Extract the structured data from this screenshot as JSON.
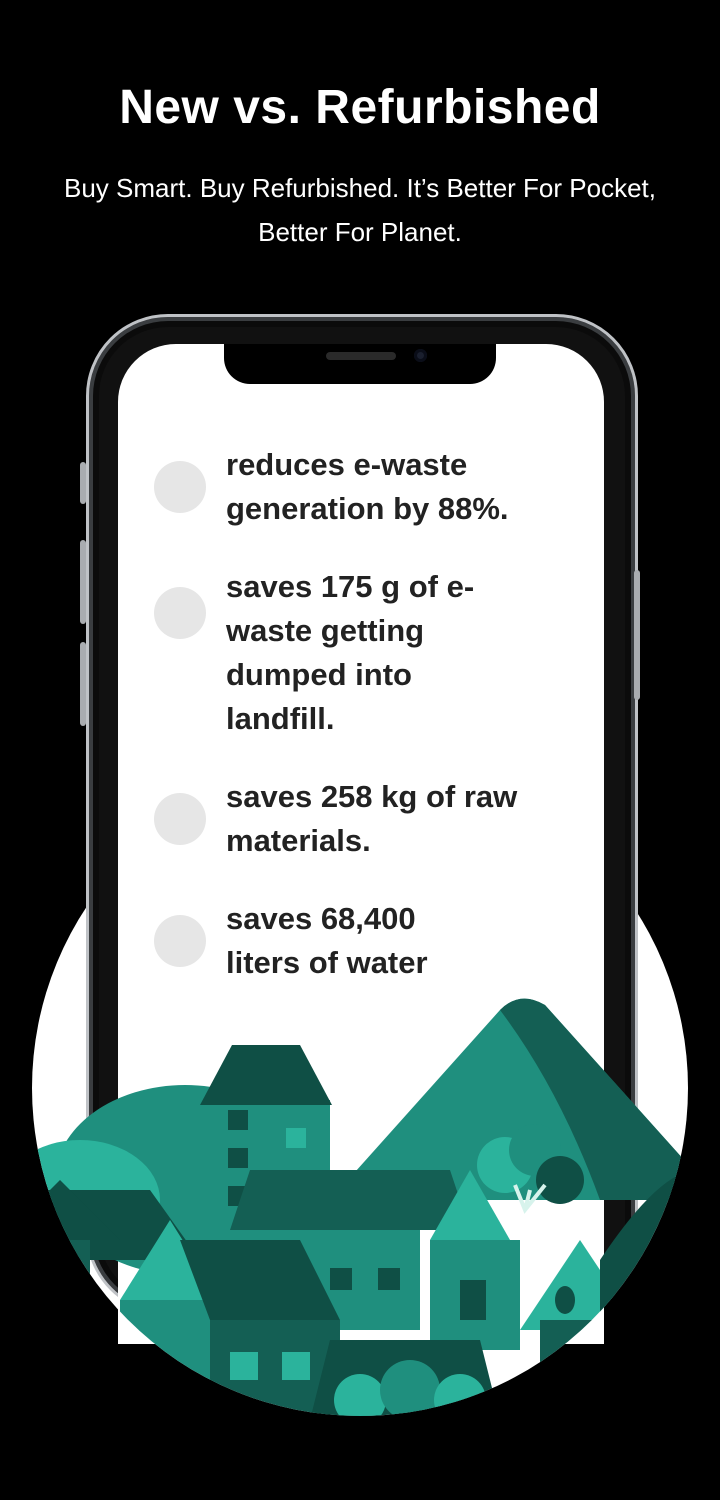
{
  "header": {
    "title": "New vs. Refurbished",
    "subtitle": "Buy Smart. Buy Refurbished. It’s Better For Pocket, Better For Planet."
  },
  "points": [
    {
      "text": "reduces e-waste generation by 88%."
    },
    {
      "text": "saves 175 g of e-waste getting dumped into landfill."
    },
    {
      "text": "saves 258 kg of raw materials."
    },
    {
      "text": "saves 68,400 liters of water"
    }
  ],
  "colors": {
    "background": "#000000",
    "teal_dark": "#0f4f45",
    "teal_mid": "#1f8f7e",
    "teal_light": "#2bb39c"
  },
  "icons": [
    "bullet-dot-icon",
    "village-illustration",
    "phone-frame"
  ]
}
